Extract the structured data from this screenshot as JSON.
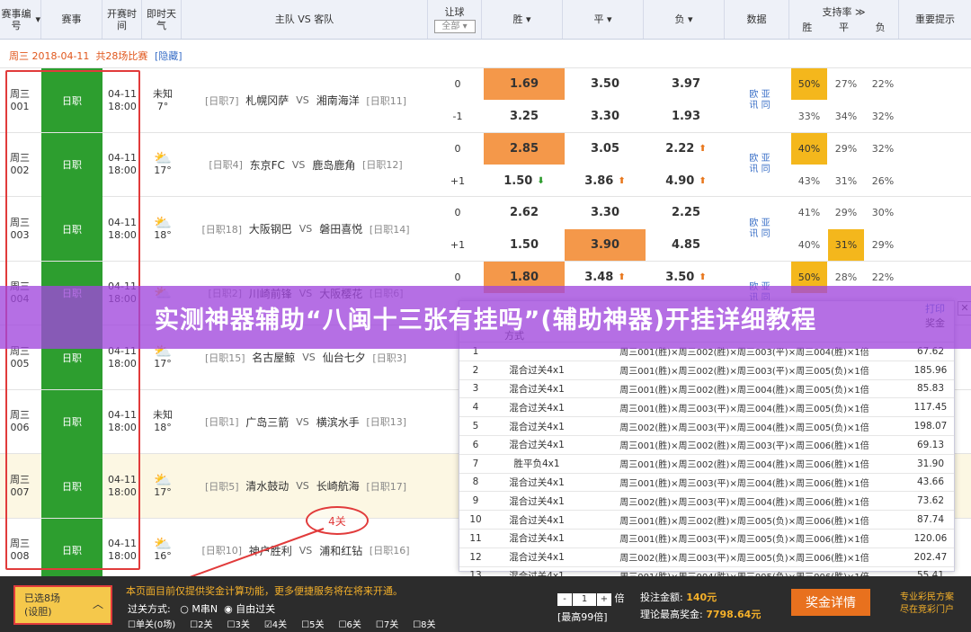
{
  "header": {
    "col_code": "赛事编号",
    "col_league": "赛事",
    "col_time": "开赛时间",
    "col_weather": "即时天气",
    "col_teams": "主队 VS 客队",
    "col_handicap": "让球",
    "col_handicap_select": "全部",
    "col_win": "胜",
    "col_draw": "平",
    "col_lose": "负",
    "col_data": "数据",
    "col_support": "支持率",
    "col_support_win": "胜",
    "col_support_draw": "平",
    "col_support_lose": "负",
    "col_tips": "重要提示"
  },
  "datebar": {
    "date": "周三 2018-04-11",
    "count": "共28场比赛",
    "hide": "[隐藏]"
  },
  "analysis": {
    "line1": "欧 亚",
    "line2": "讯 同"
  },
  "matches": [
    {
      "code1": "周三",
      "code2": "001",
      "league": "日职",
      "date": "04-11",
      "time": "18:00",
      "weather": "未知",
      "temp": "7°",
      "hrank": "[日职7]",
      "home": "札幌冈萨",
      "vs": "VS",
      "away": "湘南海洋",
      "arank": "[日职11]",
      "h1": "0",
      "o1": [
        "1.69",
        "3.50",
        "3.97"
      ],
      "h2": "-1",
      "o2": [
        "3.25",
        "3.30",
        "1.93"
      ],
      "s1": [
        "50%",
        "27%",
        "22%"
      ],
      "s2": [
        "33%",
        "34%",
        "32%"
      ]
    },
    {
      "code1": "周三",
      "code2": "002",
      "league": "日职",
      "date": "04-11",
      "time": "18:00",
      "weather": "",
      "temp": "17°",
      "hrank": "[日职4]",
      "home": "东京FC",
      "vs": "VS",
      "away": "鹿岛鹿角",
      "arank": "[日职12]",
      "h1": "0",
      "o1": [
        "2.85",
        "3.05",
        "2.22"
      ],
      "h2": "+1",
      "o2": [
        "1.50",
        "3.86",
        "4.90"
      ],
      "s1": [
        "40%",
        "29%",
        "32%"
      ],
      "s2": [
        "43%",
        "31%",
        "26%"
      ]
    },
    {
      "code1": "周三",
      "code2": "003",
      "league": "日职",
      "date": "04-11",
      "time": "18:00",
      "weather": "",
      "temp": "18°",
      "hrank": "[日职18]",
      "home": "大阪钢巴",
      "vs": "VS",
      "away": "磐田喜悦",
      "arank": "[日职14]",
      "h1": "0",
      "o1": [
        "2.62",
        "3.30",
        "2.25"
      ],
      "h2": "+1",
      "o2": [
        "1.50",
        "3.90",
        "4.85"
      ],
      "s1": [
        "41%",
        "29%",
        "30%"
      ],
      "s2": [
        "40%",
        "31%",
        "29%"
      ]
    },
    {
      "code1": "周三",
      "code2": "004",
      "league": "日职",
      "date": "04-11",
      "time": "18:00",
      "weather": "",
      "temp": "",
      "hrank": "[日职2]",
      "home": "川崎前锋",
      "vs": "VS",
      "away": "大阪樱花",
      "arank": "[日职6]",
      "h1": "0",
      "o1": [
        "1.80",
        "3.48",
        "3.50"
      ],
      "h2": "",
      "o2": [
        "",
        "",
        ""
      ],
      "s1": [
        "50%",
        "28%",
        "22%"
      ],
      "s2": [
        "",
        "",
        ""
      ]
    },
    {
      "code1": "周三",
      "code2": "005",
      "league": "日职",
      "date": "04-11",
      "time": "18:00",
      "weather": "",
      "temp": "17°",
      "hrank": "[日职15]",
      "home": "名古屋鲸",
      "vs": "VS",
      "away": "仙台七夕",
      "arank": "[日职3]",
      "h1": "",
      "o1": [
        "",
        "",
        ""
      ],
      "h2": "",
      "o2": [
        "",
        "",
        ""
      ],
      "s1": [
        "",
        "",
        ""
      ],
      "s2": [
        "",
        "",
        ""
      ]
    },
    {
      "code1": "周三",
      "code2": "006",
      "league": "日职",
      "date": "04-11",
      "time": "18:00",
      "weather": "未知",
      "temp": "18°",
      "hrank": "[日职1]",
      "home": "广岛三箭",
      "vs": "VS",
      "away": "横滨水手",
      "arank": "[日职13]",
      "h1": "",
      "o1": [
        "",
        "",
        ""
      ],
      "h2": "",
      "o2": [
        "",
        "",
        ""
      ],
      "s1": [
        "",
        "",
        ""
      ],
      "s2": [
        "",
        "",
        ""
      ]
    },
    {
      "code1": "周三",
      "code2": "007",
      "league": "日职",
      "date": "04-11",
      "time": "18:00",
      "weather": "",
      "temp": "17°",
      "hrank": "[日职5]",
      "home": "清水鼓动",
      "vs": "VS",
      "away": "长崎航海",
      "arank": "[日职17]",
      "h1": "",
      "o1": [
        "",
        "",
        ""
      ],
      "h2": "",
      "o2": [
        "",
        "",
        ""
      ],
      "s1": [
        "",
        "",
        ""
      ],
      "s2": [
        "",
        "",
        ""
      ]
    },
    {
      "code1": "周三",
      "code2": "008",
      "league": "日职",
      "date": "04-11",
      "time": "18:00",
      "weather": "",
      "temp": "16°",
      "hrank": "[日职10]",
      "home": "神户胜利",
      "vs": "VS",
      "away": "浦和红钻",
      "arank": "[日职16]",
      "h1": "",
      "o1": [
        "",
        "",
        ""
      ],
      "h2": "",
      "o2": [
        "",
        "",
        ""
      ],
      "s1": [
        "",
        "",
        ""
      ],
      "s2": [
        "",
        "",
        ""
      ]
    }
  ],
  "banner": {
    "text": "实测神器辅助“八闽十三张有挂吗”(辅助神器)开挂详细教程"
  },
  "panel": {
    "print": "打印",
    "col_prize": "奖金",
    "col_mode": "方式",
    "rows": [
      {
        "n": "1",
        "mode": "",
        "detail": "周三001(胜)×周三002(胜)×周三003(平)×周三004(胜)×1倍",
        "prize": "67.62"
      },
      {
        "n": "2",
        "mode": "混合过关4x1",
        "detail": "周三001(胜)×周三002(胜)×周三003(平)×周三005(负)×1倍",
        "prize": "185.96"
      },
      {
        "n": "3",
        "mode": "混合过关4x1",
        "detail": "周三001(胜)×周三002(胜)×周三004(胜)×周三005(负)×1倍",
        "prize": "85.83"
      },
      {
        "n": "4",
        "mode": "混合过关4x1",
        "detail": "周三001(胜)×周三003(平)×周三004(胜)×周三005(负)×1倍",
        "prize": "117.45"
      },
      {
        "n": "5",
        "mode": "混合过关4x1",
        "detail": "周三002(胜)×周三003(平)×周三004(胜)×周三005(负)×1倍",
        "prize": "198.07"
      },
      {
        "n": "6",
        "mode": "混合过关4x1",
        "detail": "周三001(胜)×周三002(胜)×周三003(平)×周三006(胜)×1倍",
        "prize": "69.13"
      },
      {
        "n": "7",
        "mode": "胜平负4x1",
        "detail": "周三001(胜)×周三002(胜)×周三004(胜)×周三006(胜)×1倍",
        "prize": "31.90"
      },
      {
        "n": "8",
        "mode": "混合过关4x1",
        "detail": "周三001(胜)×周三003(平)×周三004(胜)×周三006(胜)×1倍",
        "prize": "43.66"
      },
      {
        "n": "9",
        "mode": "混合过关4x1",
        "detail": "周三002(胜)×周三003(平)×周三004(胜)×周三006(胜)×1倍",
        "prize": "73.62"
      },
      {
        "n": "10",
        "mode": "混合过关4x1",
        "detail": "周三001(胜)×周三002(胜)×周三005(负)×周三006(胜)×1倍",
        "prize": "87.74"
      },
      {
        "n": "11",
        "mode": "混合过关4x1",
        "detail": "周三001(胜)×周三003(平)×周三005(负)×周三006(胜)×1倍",
        "prize": "120.06"
      },
      {
        "n": "12",
        "mode": "混合过关4x1",
        "detail": "周三002(胜)×周三003(平)×周三005(负)×周三006(胜)×1倍",
        "prize": "202.47"
      },
      {
        "n": "13",
        "mode": "混合过关4x1",
        "detail": "周三001(胜)×周三004(胜)×周三005(负)×周三006(胜)×1倍",
        "prize": "55.41"
      }
    ]
  },
  "annotation": {
    "four": "4关"
  },
  "footer": {
    "selected": "已选8场",
    "settings": "(设胆)",
    "notice": "本页面目前仅提供奖金计算功能，更多便捷服务将在将来开通。",
    "mode_label": "过关方式:",
    "mode_mn": "M串N",
    "mode_free": "自由过关",
    "checks": [
      "单关(0场)",
      "2关",
      "3关",
      "4关",
      "5关",
      "6关",
      "7关",
      "8关"
    ],
    "mult_minus": "-",
    "mult_value": "1",
    "mult_plus": "+",
    "mult_unit": "倍",
    "mult_max": "[最高99倍]",
    "total_label": "投注金额:",
    "total_value": "140元",
    "max_label": "理论最高奖金:",
    "max_value": "7798.64元",
    "prize_button": "奖金详情",
    "logo1": "专业彩民方案",
    "logo2": "尽在竞彩门户"
  }
}
